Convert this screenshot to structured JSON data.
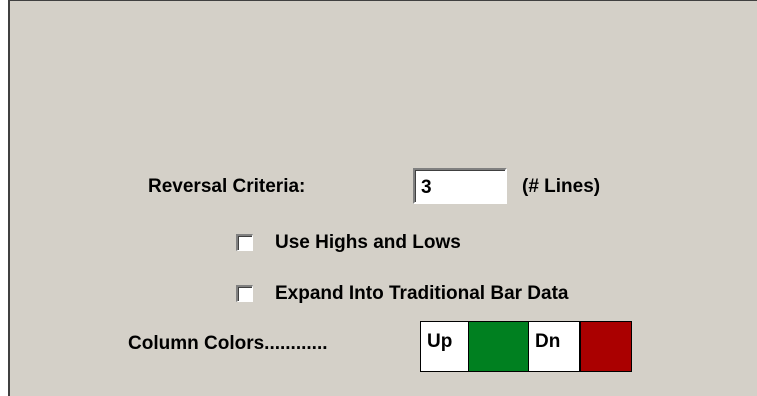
{
  "reversal": {
    "label": "Reversal Criteria:",
    "value": "3",
    "unit_label": "(# Lines)"
  },
  "options": [
    {
      "label": "Use Highs and Lows",
      "checked": false
    },
    {
      "label": "Expand Into Traditional Bar Data",
      "checked": false
    }
  ],
  "column_colors": {
    "label": "Column Colors............",
    "up_label": "Up",
    "up_color": "#008020",
    "dn_label": "Dn",
    "dn_color": "#aa0000"
  },
  "colors": {
    "panel_background": "#d4d0c8"
  }
}
